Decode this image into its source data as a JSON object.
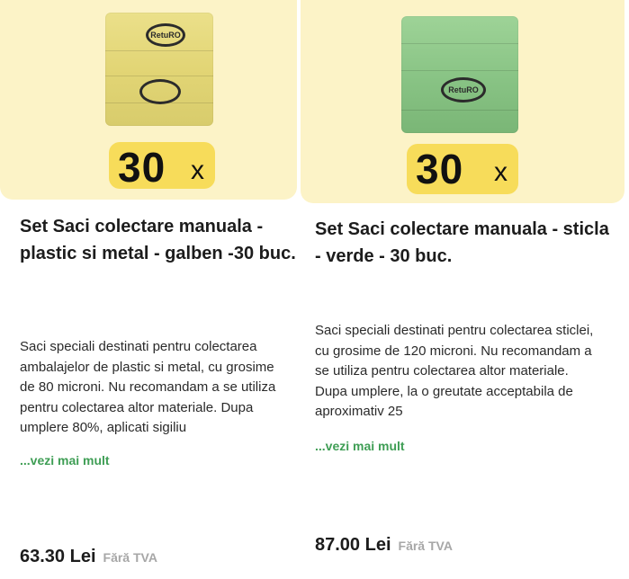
{
  "products": [
    {
      "qty_number": "30",
      "qty_suffix": "x",
      "brand": "RetuRO",
      "title": "Set Saci colectare manuala - plastic si metal - galben -30 buc.",
      "description": "Saci speciali destinati pentru colectarea ambalajelor de plastic si metal, cu grosime de 80 microni. Nu recomandam a se utiliza pentru colectarea altor materiale. Dupa umplere 80%, aplicati sigiliu",
      "more_label": "...vezi mai mult",
      "price": "63.30 Lei",
      "vat_label": "Fără TVA",
      "bag_color": "#e2d575",
      "badge_color": "#f7dc5a"
    },
    {
      "qty_number": "30",
      "qty_suffix": "x",
      "brand": "RetuRO",
      "title": "Set Saci colectare manuala - sticla - verde - 30 buc.",
      "description": "Saci speciali destinati pentru colectarea sticlei, cu grosime de 120 microni. Nu recomandam a se utiliza pentru colectarea altor materiale. Dupa umplere, la o greutate acceptabila de aproximativ 25",
      "more_label": "...vezi mai mult",
      "price": "87.00 Lei",
      "vat_label": "Fără TVA",
      "bag_color": "#88c384",
      "badge_color": "#f7dc5a"
    }
  ]
}
